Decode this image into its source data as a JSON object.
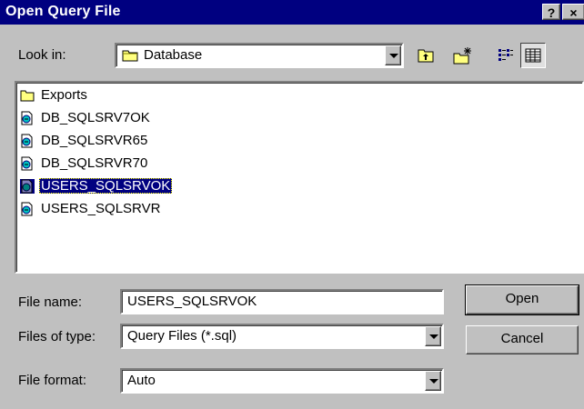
{
  "window": {
    "title": "Open Query File",
    "help_glyph": "?",
    "close_glyph": "×"
  },
  "lookin": {
    "label": "Look in:",
    "value": "Database",
    "icon": "folder-icon"
  },
  "toolbar": {
    "up_icon": "up-one-level-icon",
    "newfolder_icon": "new-folder-icon",
    "list_icon": "list-view-icon",
    "details_icon": "details-view-icon"
  },
  "files": [
    {
      "name": "Exports",
      "type": "folder"
    },
    {
      "name": "DB_SQLSRV7OK",
      "type": "file"
    },
    {
      "name": "DB_SQLSRVR65",
      "type": "file"
    },
    {
      "name": "DB_SQLSRVR70",
      "type": "file"
    },
    {
      "name": "USERS_SQLSRVOK",
      "type": "file",
      "selected": true
    },
    {
      "name": "USERS_SQLSRVR",
      "type": "file"
    }
  ],
  "form": {
    "filename_label": "File name:",
    "filename_value": "USERS_SQLSRVOK",
    "filetype_label": "Files of type:",
    "filetype_value": "Query Files (*.sql)",
    "fileformat_label": "File format:",
    "fileformat_value": "Auto"
  },
  "buttons": {
    "open": "Open",
    "cancel": "Cancel"
  },
  "colors": {
    "titlebar": "#000080",
    "face": "#c0c0c0",
    "selection": "#000080"
  }
}
